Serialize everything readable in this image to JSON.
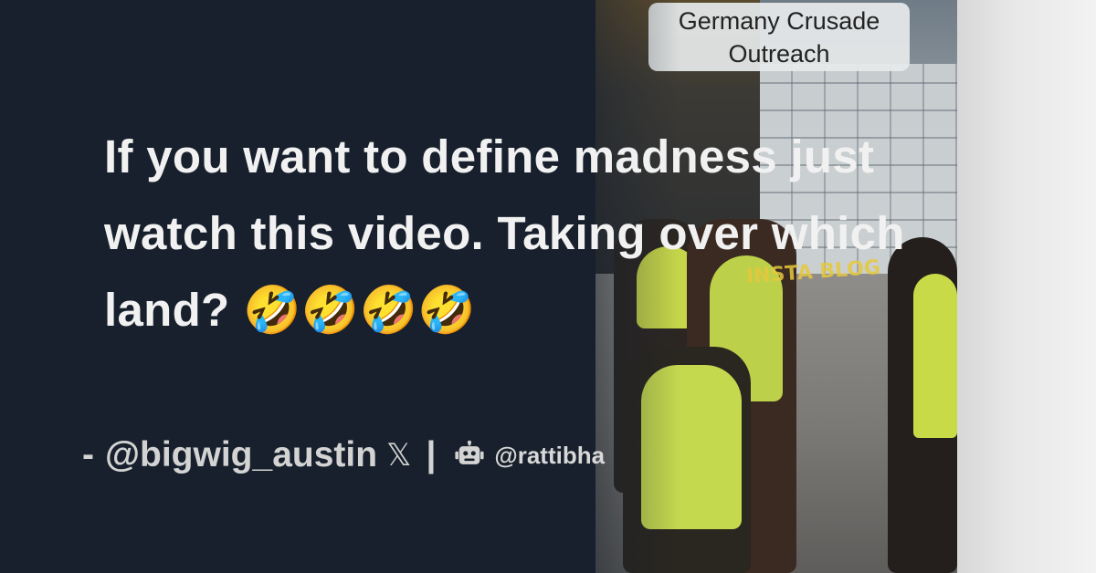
{
  "video_caption": {
    "line1": "Germany Crusade",
    "line2": "Outreach"
  },
  "watermark": "INSTA BLOG",
  "tweet": {
    "text": "If you want to define madness just watch this video. Taking over which land? 🤣🤣🤣🤣"
  },
  "attribution": {
    "dash": "-",
    "handle": "@bigwig_austin",
    "x_symbol": "𝕏",
    "separator": "|",
    "site_handle": "@rattibha"
  },
  "icons": [
    "x-logo-icon",
    "robot-icon"
  ],
  "colors": {
    "background": "#17202c",
    "text": "#f1f1f1",
    "muted_text": "#d3d3d3"
  }
}
